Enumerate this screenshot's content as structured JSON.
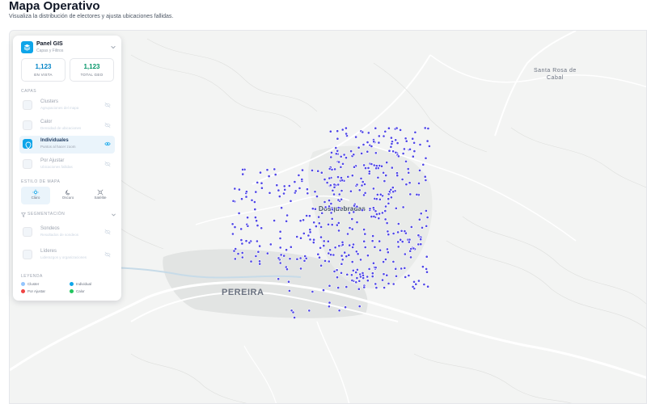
{
  "header": {
    "title": "Mapa Operativo",
    "subtitle": "Visualiza la distribución de electores y ajusta ubicaciones fallidas."
  },
  "map": {
    "labels": {
      "pereira": "PEREIRA",
      "dosquebradas": "Dosquebradas",
      "santa_rosa": "Santa Rosa de\nCabal"
    },
    "point_color": "#4f46e5",
    "point_count": 1123
  },
  "panel": {
    "title": "Panel GIS",
    "subtitle": "Capas y Filtros",
    "stats": [
      {
        "value": "1,123",
        "label": "EN VISTA"
      },
      {
        "value": "1,123",
        "label": "TOTAL GEO"
      }
    ],
    "layers_label": "CAPAS",
    "layers": [
      {
        "name": "Clusters",
        "desc": "Agrupaciones del mapa",
        "active": false,
        "icon": "cluster-icon"
      },
      {
        "name": "Calor",
        "desc": "Densidad de ubicaciones",
        "active": false,
        "icon": "heat-icon"
      },
      {
        "name": "Individuales",
        "desc": "Puntos al hacer zoom",
        "active": true,
        "icon": "pin-icon"
      },
      {
        "name": "Por Ajustar",
        "desc": "Ubicaciones fallidas",
        "active": false,
        "icon": "adjust-icon"
      }
    ],
    "style_label": "ESTILO DE MAPA",
    "styles": [
      {
        "name": "Claro",
        "icon": "sun-icon",
        "active": true
      },
      {
        "name": "Oscuro",
        "icon": "moon-icon",
        "active": false
      },
      {
        "name": "Satélite",
        "icon": "satellite-icon",
        "active": false
      }
    ],
    "segmentation_label": "SEGMENTACIÓN",
    "segments": [
      {
        "name": "Sondeos",
        "desc": "Resultados de sondeos"
      },
      {
        "name": "Líderes",
        "desc": "Liderazgos y organizaciones"
      }
    ],
    "legend_label": "LEYENDA",
    "legend": [
      {
        "name": "Cluster",
        "color": "#93c5fd"
      },
      {
        "name": "Individual",
        "color": "#0ea5e9"
      },
      {
        "name": "Por Ajustar",
        "color": "#ef4444"
      },
      {
        "name": "Calor",
        "color": "#22c55e"
      }
    ]
  }
}
